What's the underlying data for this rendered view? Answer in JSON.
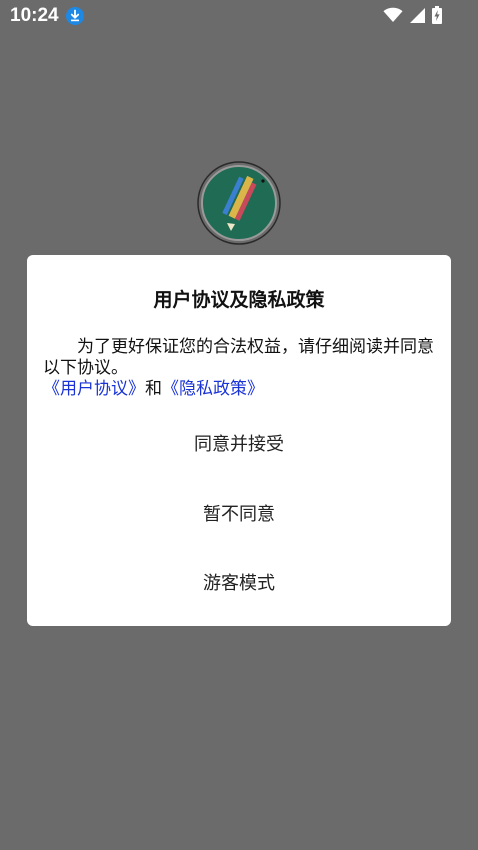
{
  "status_bar": {
    "time": "10:24",
    "icons": [
      "download-icon",
      "wifi-icon",
      "signal-icon",
      "battery-charging-icon"
    ]
  },
  "dialog": {
    "title": "用户协议及隐私政策",
    "body_text": "为了更好保证您的合法权益，请仔细阅读并同意以下协议。",
    "link_user_agreement": "《用户协议》",
    "connector": "和",
    "link_privacy_policy": "《隐私政策》",
    "actions": {
      "agree": "同意并接受",
      "disagree": "暂不同意",
      "guest": "游客模式"
    }
  },
  "colors": {
    "overlay": "#6b6b6b",
    "link": "#1a33d6",
    "download_badge": "#1e88e5",
    "logo_bg": "#1f6b53"
  }
}
